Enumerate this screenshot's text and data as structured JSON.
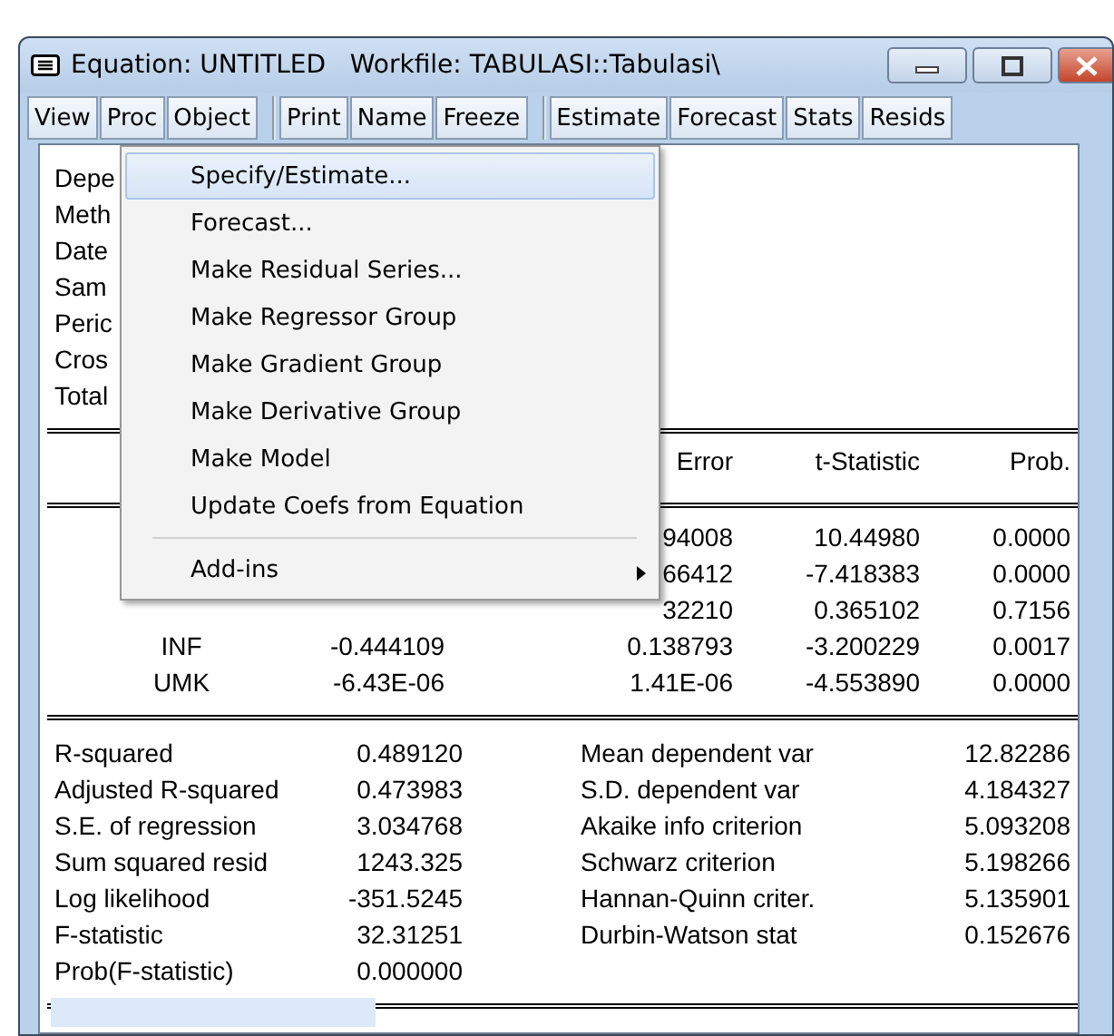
{
  "window": {
    "title": "Equation: UNTITLED   Workfile: TABULASI::Tabulasi\\"
  },
  "toolbar": [
    [
      "View",
      "Proc",
      "Object"
    ],
    [
      "Print",
      "Name",
      "Freeze"
    ],
    [
      "Estimate",
      "Forecast",
      "Stats",
      "Resids"
    ]
  ],
  "header_lines": [
    "Depe",
    "Meth",
    "Date",
    "Sam",
    "Peric",
    "Cros",
    "Total"
  ],
  "coef_table": {
    "columns": {
      "std_error": "Error",
      "t_statistic": "t-Statistic",
      "prob": "Prob."
    },
    "rows": [
      {
        "std_error": "94008",
        "t_statistic": "10.44980",
        "prob": "0.0000"
      },
      {
        "std_error": "66412",
        "t_statistic": "-7.418383",
        "prob": "0.0000"
      },
      {
        "std_error": "32210",
        "t_statistic": "0.365102",
        "prob": "0.7156"
      },
      {
        "variable": "INF",
        "coefficient": "-0.444109",
        "std_error": "0.138793",
        "t_statistic": "-3.200229",
        "prob": "0.0017"
      },
      {
        "variable": "UMK",
        "coefficient": "-6.43E-06",
        "std_error": "1.41E-06",
        "t_statistic": "-4.553890",
        "prob": "0.0000"
      }
    ]
  },
  "stats": [
    {
      "label": "R-squared",
      "value": "0.489120",
      "label_2": "Mean dependent var",
      "value_2": "12.82286"
    },
    {
      "label": "Adjusted R-squared",
      "value": "0.473983",
      "label_2": "S.D. dependent var",
      "value_2": "4.184327"
    },
    {
      "label": "S.E. of regression",
      "value": "3.034768",
      "label_2": "Akaike info criterion",
      "value_2": "5.093208"
    },
    {
      "label": "Sum squared resid",
      "value": "1243.325",
      "label_2": "Schwarz criterion",
      "value_2": "5.198266"
    },
    {
      "label": "Log likelihood",
      "value": "-351.5245",
      "label_2": "Hannan-Quinn criter.",
      "value_2": "5.135901"
    },
    {
      "label": "F-statistic",
      "value": "32.31251",
      "label_2": "Durbin-Watson stat",
      "value_2": "0.152676"
    },
    {
      "label": "Prob(F-statistic)",
      "value": "0.000000"
    }
  ],
  "menu": [
    {
      "kind": "item",
      "label": "Specify/Estimate...",
      "selected": true,
      "has_submenu": false
    },
    {
      "kind": "item",
      "label": "Forecast...",
      "selected": false,
      "has_submenu": false
    },
    {
      "kind": "item",
      "label": "Make Residual Series...",
      "selected": false,
      "has_submenu": false
    },
    {
      "kind": "item",
      "label": "Make Regressor Group",
      "selected": false,
      "has_submenu": false
    },
    {
      "kind": "item",
      "label": "Make Gradient Group",
      "selected": false,
      "has_submenu": false
    },
    {
      "kind": "item",
      "label": "Make Derivative Group",
      "selected": false,
      "has_submenu": false
    },
    {
      "kind": "item",
      "label": "Make Model",
      "selected": false,
      "has_submenu": false
    },
    {
      "kind": "item",
      "label": "Update Coefs from Equation",
      "selected": false,
      "has_submenu": false
    },
    {
      "kind": "separator"
    },
    {
      "kind": "item",
      "label": "Add-ins",
      "selected": false,
      "has_submenu": true
    }
  ]
}
